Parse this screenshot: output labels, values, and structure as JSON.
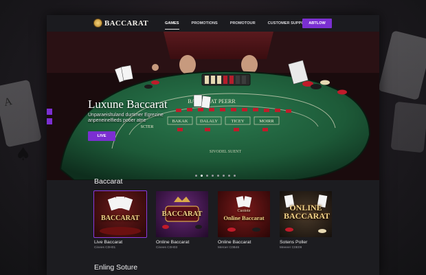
{
  "nav": {
    "logo": "BACCARAT",
    "links": [
      "GAMES",
      "PROMOTIONS",
      "PROMOTOUR",
      "CUSTOMER SUPPORT"
    ],
    "cta": "ABTLOW"
  },
  "hero": {
    "title": "Luxune Baccarat",
    "subtitle": "Unparaeisltuland durtimer Egrezine anpeneinelfieds pooer atne",
    "button": "LIVE",
    "table_text": {
      "row1": "BACCARAT PEERR",
      "bets": [
        "BAKAK",
        "DALALY",
        "TICEY",
        "MOIRR"
      ],
      "bottom": "SIVODEL SUENT",
      "side": "SCTER"
    },
    "slides": 8,
    "active_slide": 1
  },
  "sections": {
    "games_title": "Baccarat",
    "next_title": "Enling Soture"
  },
  "games": [
    {
      "thumb_text": "BACCARAT",
      "name": "Live Baccarat",
      "meta": "Cinees C0H01"
    },
    {
      "thumb_text": "BACCARAT",
      "name": "Online Baccarat",
      "meta": "Cinees C0H03"
    },
    {
      "thumb_top": "Cuoiote",
      "thumb_text": "Online Baccarat",
      "name": "Online Baccarat",
      "meta": "Meroer C0B46"
    },
    {
      "thumb_text": "ONLINE BACCARAT",
      "name": "Sotens Poller",
      "meta": "Meeeer C0E09"
    }
  ],
  "colors": {
    "accent": "#7b2fd1",
    "felt": "#1f5a3a",
    "gold": "#f3d48a"
  }
}
